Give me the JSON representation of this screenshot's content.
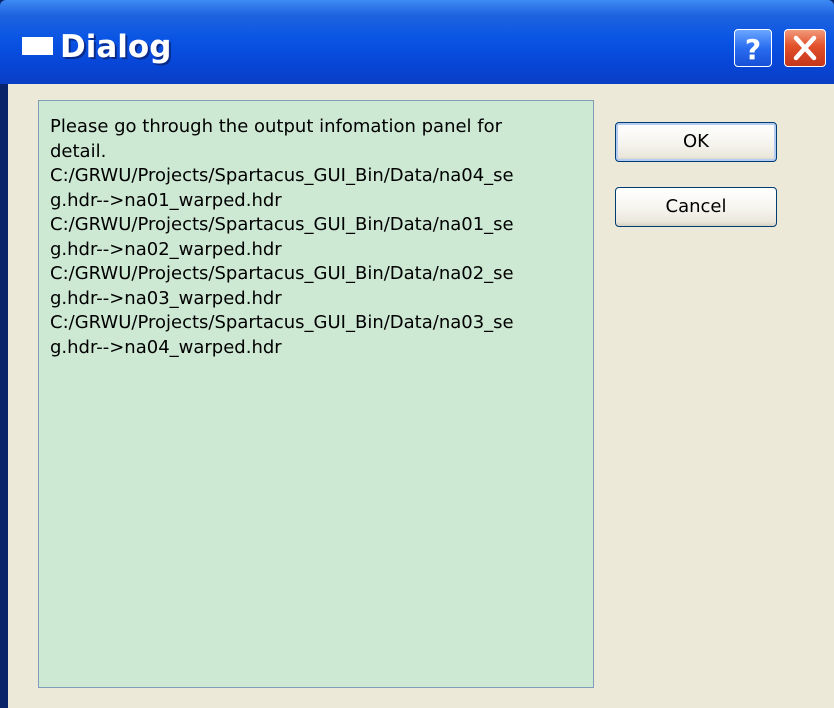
{
  "window": {
    "title": "Dialog"
  },
  "titlebar_buttons": {
    "help": "?",
    "close_icon": "close-x-icon"
  },
  "message": {
    "lines": [
      "Please go through the output infomation panel for",
      "detail.",
      "C:/GRWU/Projects/Spartacus_GUI_Bin/Data/na04_se",
      "g.hdr-->na01_warped.hdr",
      "C:/GRWU/Projects/Spartacus_GUI_Bin/Data/na01_se",
      "g.hdr-->na02_warped.hdr",
      "C:/GRWU/Projects/Spartacus_GUI_Bin/Data/na02_se",
      "g.hdr-->na03_warped.hdr",
      "C:/GRWU/Projects/Spartacus_GUI_Bin/Data/na03_se",
      "g.hdr-->na04_warped.hdr"
    ]
  },
  "buttons": {
    "ok": "OK",
    "cancel": "Cancel"
  },
  "colors": {
    "titlebar": "#0a55e4",
    "client_background": "#ece9d8",
    "panel_background": "#cde8d3",
    "close_button": "#e2512a"
  }
}
